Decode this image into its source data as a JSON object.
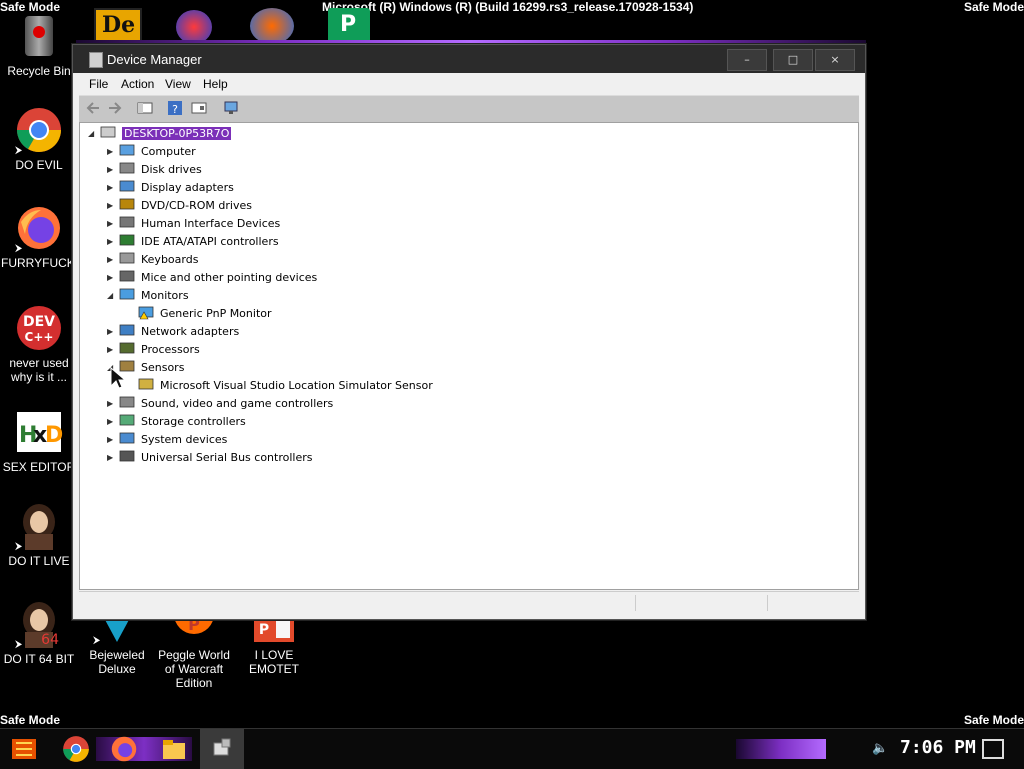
{
  "safe_mode": {
    "top_left": "Safe Mode",
    "top_right": "Safe Mode",
    "bottom_left": "Safe Mode",
    "bottom_right": "Safe Mode"
  },
  "build_text": "Microsoft (R) Windows (R) (Build 16299.rs3_release.170928-1534)",
  "desktop_icons": [
    {
      "label": "Recycle Bin",
      "icon": "recycle-bin-icon"
    },
    {
      "label": "DO EVIL",
      "icon": "chrome-icon"
    },
    {
      "label": "FURRYFUCK!",
      "icon": "firefox-icon"
    },
    {
      "label": "never used why is it ...",
      "icon": "devcpp-icon"
    },
    {
      "label": "SEX EDITOR",
      "icon": "hxd-icon"
    },
    {
      "label": "DO IT LIVE",
      "icon": "portrait-icon"
    },
    {
      "label": "DO IT 64 BIT",
      "icon": "portrait64-icon"
    },
    {
      "label": "Bejeweled Deluxe",
      "icon": "bejeweled-icon"
    },
    {
      "label": "Peggle World of Warcraft Edition",
      "icon": "peggle-icon"
    },
    {
      "label": "I LOVE EMOTET",
      "icon": "powerpoint-icon"
    }
  ],
  "window": {
    "title": "Device Manager",
    "buttons": {
      "minimize": "–",
      "maximize": "□",
      "close": "×"
    },
    "menu": [
      "File",
      "Action",
      "View",
      "Help"
    ],
    "tree": {
      "root": "DESKTOP-0P53R7O",
      "nodes": [
        {
          "label": "Computer",
          "state": "collapsed",
          "icon": "computer-icon"
        },
        {
          "label": "Disk drives",
          "state": "collapsed",
          "icon": "disk-drive-icon"
        },
        {
          "label": "Display adapters",
          "state": "collapsed",
          "icon": "display-adapter-icon"
        },
        {
          "label": "DVD/CD-ROM drives",
          "state": "collapsed",
          "icon": "dvd-icon"
        },
        {
          "label": "Human Interface Devices",
          "state": "collapsed",
          "icon": "hid-icon"
        },
        {
          "label": "IDE ATA/ATAPI controllers",
          "state": "collapsed",
          "icon": "ide-icon"
        },
        {
          "label": "Keyboards",
          "state": "collapsed",
          "icon": "keyboard-icon"
        },
        {
          "label": "Mice and other pointing devices",
          "state": "collapsed",
          "icon": "mouse-icon"
        },
        {
          "label": "Monitors",
          "state": "expanded",
          "icon": "monitor-icon",
          "children": [
            {
              "label": "Generic PnP Monitor",
              "icon": "warning-monitor-icon"
            }
          ]
        },
        {
          "label": "Network adapters",
          "state": "collapsed",
          "icon": "network-icon"
        },
        {
          "label": "Processors",
          "state": "collapsed",
          "icon": "processor-icon"
        },
        {
          "label": "Sensors",
          "state": "expanded",
          "icon": "sensor-icon",
          "children": [
            {
              "label": "Microsoft Visual Studio Location Simulator Sensor",
              "icon": "sensor-device-icon"
            }
          ]
        },
        {
          "label": "Sound, video and game controllers",
          "state": "collapsed",
          "icon": "speaker-icon"
        },
        {
          "label": "Storage controllers",
          "state": "collapsed",
          "icon": "storage-icon"
        },
        {
          "label": "System devices",
          "state": "collapsed",
          "icon": "system-icon"
        },
        {
          "label": "Universal Serial Bus controllers",
          "state": "collapsed",
          "icon": "usb-icon"
        }
      ]
    }
  },
  "taskbar": {
    "clock": "7:06 PM",
    "apps": [
      "start-icon",
      "chrome-icon",
      "firefox-icon",
      "file-explorer-icon",
      "device-manager-icon"
    ]
  },
  "colors": {
    "accent": "#7b2fb8",
    "titlebar": "#2b2b2b"
  }
}
